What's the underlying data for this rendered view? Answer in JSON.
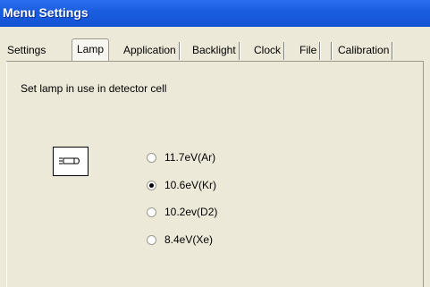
{
  "window": {
    "title": "Menu Settings"
  },
  "tabs": [
    {
      "label": "Settings",
      "active": false
    },
    {
      "label": "Lamp",
      "active": true
    },
    {
      "label": "Application",
      "active": false
    },
    {
      "label": "Backlight",
      "active": false
    },
    {
      "label": "Clock",
      "active": false
    },
    {
      "label": "File",
      "active": false
    },
    {
      "label": "Calibration",
      "active": false
    }
  ],
  "lamp_panel": {
    "description": "Set lamp in use in detector cell",
    "lamp_icon": "lamp-icon",
    "options": [
      {
        "label": "11.7eV(Ar)",
        "selected": false
      },
      {
        "label": "10.6eV(Kr)",
        "selected": true
      },
      {
        "label": "10.2ev(D2)",
        "selected": false
      },
      {
        "label": "8.4eV(Xe)",
        "selected": false
      }
    ]
  },
  "colors": {
    "titlebar": "#1a5ee0",
    "dialog_bg": "#ece9d8",
    "title_text": "#ffffff"
  }
}
